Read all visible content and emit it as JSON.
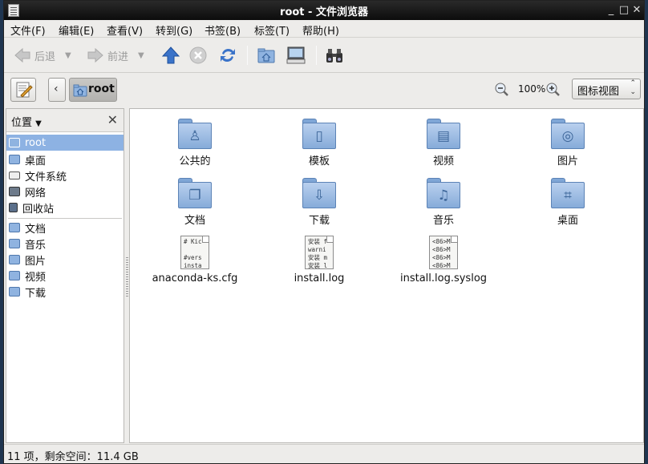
{
  "window": {
    "title": "root - 文件浏览器",
    "controls": [
      "minimize-icon",
      "maximize-icon",
      "close-icon"
    ]
  },
  "menu": {
    "file": "文件(F)",
    "edit": "编辑(E)",
    "view": "查看(V)",
    "go": "转到(G)",
    "bookmarks": "书签(B)",
    "tabs": "标签(T)",
    "help": "帮助(H)"
  },
  "toolbar": {
    "back_label": "后退",
    "forward_label": "前进",
    "icons": [
      "arrow-left-icon",
      "arrow-right-icon",
      "arrow-up-icon",
      "stop-icon",
      "reload-icon",
      "home-folder-icon",
      "computer-icon",
      "binoculars-icon"
    ]
  },
  "location": {
    "path_button": "root",
    "zoom_level": "100%",
    "view_mode": "图标视图"
  },
  "sidebar": {
    "header": "位置",
    "places": [
      {
        "label": "root",
        "icon": "home-folder-icon",
        "selected": true
      },
      {
        "label": "桌面",
        "icon": "desktop-folder-icon"
      },
      {
        "label": "文件系统",
        "icon": "drive-icon"
      },
      {
        "label": "网络",
        "icon": "network-icon"
      },
      {
        "label": "回收站",
        "icon": "trash-icon"
      }
    ],
    "bookmarks": [
      {
        "label": "文档",
        "icon": "documents-folder-icon"
      },
      {
        "label": "音乐",
        "icon": "music-folder-icon"
      },
      {
        "label": "图片",
        "icon": "pictures-folder-icon"
      },
      {
        "label": "视频",
        "icon": "videos-folder-icon"
      },
      {
        "label": "下载",
        "icon": "downloads-folder-icon"
      }
    ]
  },
  "files": [
    {
      "name": "公共的",
      "type": "folder",
      "emblem": "person"
    },
    {
      "name": "模板",
      "type": "folder",
      "emblem": "template"
    },
    {
      "name": "视频",
      "type": "folder",
      "emblem": "film"
    },
    {
      "name": "图片",
      "type": "folder",
      "emblem": "camera"
    },
    {
      "name": "文档",
      "type": "folder",
      "emblem": "document"
    },
    {
      "name": "下载",
      "type": "folder",
      "emblem": "download"
    },
    {
      "name": "音乐",
      "type": "folder",
      "emblem": "music"
    },
    {
      "name": "桌面",
      "type": "folder",
      "emblem": "desktop"
    },
    {
      "name": "anaconda-ks.cfg",
      "type": "file",
      "preview": "# Kic\n\n#vers\ninsta"
    },
    {
      "name": "install.log",
      "type": "file",
      "preview": "安装 f\nwarni\n安装 m\n安装 l"
    },
    {
      "name": "install.log.syslog",
      "type": "file",
      "preview": "<86>M\n<86>M\n<86>M\n<86>M"
    }
  ],
  "status": {
    "text": "11 项，剩余空间：11.4 GB"
  },
  "colors": {
    "accent": "#8db2e3",
    "folder": "#86abd9",
    "titlebar": "#0c0c0c"
  }
}
